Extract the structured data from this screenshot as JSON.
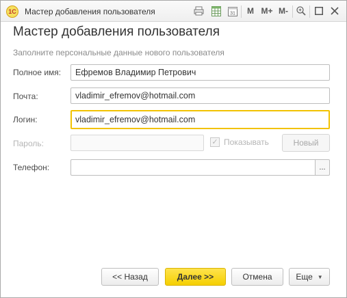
{
  "window": {
    "app_icon_text": "1С",
    "title": "Мастер добавления пользователя",
    "toolbar": {
      "memory_m": "M",
      "memory_m_plus": "M+",
      "memory_m_minus": "M-"
    }
  },
  "form": {
    "heading": "Мастер добавления пользователя",
    "subheading": "Заполните персональные данные нового пользователя",
    "fields": {
      "full_name": {
        "label": "Полное имя:",
        "value": "Ефремов Владимир Петрович"
      },
      "email": {
        "label": "Почта:",
        "value": "vladimir_efremov@hotmail.com"
      },
      "login": {
        "label": "Логин:",
        "value": "vladimir_efremov@hotmail.com"
      },
      "password": {
        "label": "Пароль:",
        "value": ""
      },
      "phone": {
        "label": "Телефон:",
        "value": "",
        "select_button": "..."
      }
    },
    "show_password": {
      "label": "Показывать",
      "checked": true
    },
    "new_password_button": "Новый"
  },
  "footer": {
    "back_button": "<< Назад",
    "next_button": "Далее >>",
    "cancel_button": "Отмена",
    "more_button": "Еще"
  },
  "colors": {
    "accent": "#f5cf00",
    "focus_border": "#f2c200"
  }
}
